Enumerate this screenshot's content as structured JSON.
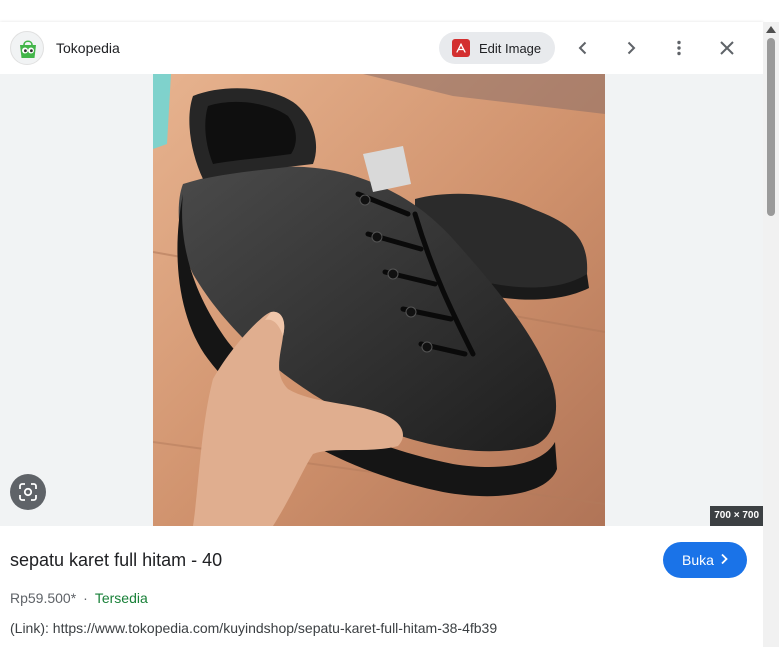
{
  "header": {
    "site_name": "Tokopedia",
    "edit_label": "Edit Image",
    "icons": [
      "tokopedia-logo",
      "pdf-icon",
      "chevron-left-icon",
      "chevron-right-icon",
      "more-vert-icon",
      "close-icon"
    ]
  },
  "viewer": {
    "image_alt": "black rubber sneaker held in hand",
    "dimensions": "700 × 700"
  },
  "details": {
    "title": "sepatu karet full hitam - 40",
    "open_label": "Buka",
    "price": "Rp59.500*",
    "separator": "·",
    "availability": "Tersedia",
    "link": "(Link): https://www.tokopedia.com/kuyindshop/sepatu-karet-full-hitam-38-4fb39"
  },
  "colors": {
    "accent": "#1a73e8",
    "availability": "#188038",
    "brand": "#42b549"
  }
}
